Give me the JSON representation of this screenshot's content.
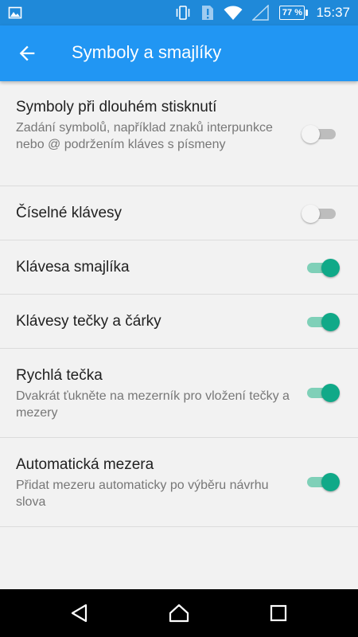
{
  "status_bar": {
    "icons": [
      "image-icon",
      "vibrate-icon",
      "alert-icon",
      "wifi-icon",
      "signal-icon"
    ],
    "battery": "77 %",
    "time": "15:37"
  },
  "app_bar": {
    "title": "Symboly a smajlíky",
    "back_icon": "arrow-back-icon"
  },
  "settings": [
    {
      "title": "Symboly při dlouhém stisknutí",
      "subtitle": "Zadání symbolů, například znaků interpunkce nebo @ podržením kláves s písmeny",
      "enabled": false
    },
    {
      "title": "Číselné klávesy",
      "subtitle": "",
      "enabled": false
    },
    {
      "title": "Klávesa smajlíka",
      "subtitle": "",
      "enabled": true
    },
    {
      "title": "Klávesy tečky a čárky",
      "subtitle": "",
      "enabled": true
    },
    {
      "title": "Rychlá tečka",
      "subtitle": "Dvakrát ťukněte na mezerník pro vložení tečky a mezery",
      "enabled": true
    },
    {
      "title": "Automatická mezera",
      "subtitle": "Přidat mezeru automaticky po výběru návrhu slova",
      "enabled": true
    }
  ],
  "colors": {
    "status_bar": "#1f89d9",
    "app_bar": "#2196f3",
    "switch_on": "#10a988",
    "switch_off": "#bdbdbd"
  },
  "nav_bar": {
    "icons": [
      "back-triangle-icon",
      "home-icon",
      "recents-icon"
    ]
  }
}
